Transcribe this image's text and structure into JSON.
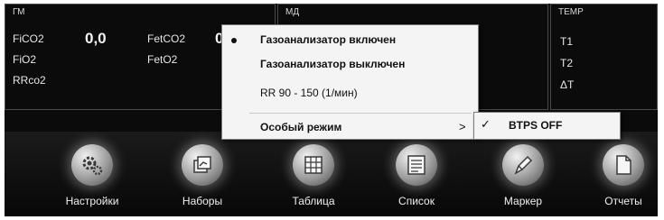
{
  "gm": {
    "title": "ГМ",
    "fico2_label": "FiCO2",
    "fico2_value": "0,0",
    "fio2_label": "FiO2",
    "rrco2_label": "RRco2",
    "fetco2_label": "FetCO2",
    "fetco2_value": "0",
    "feto2_label": "FetO2"
  },
  "md": {
    "title": "МД"
  },
  "temp": {
    "title": "TEMP",
    "t1_label": "T1",
    "t2_label": "T2",
    "dt_label": "ΔT"
  },
  "dock": {
    "items": [
      {
        "label": "Настройки",
        "icon": "gears-icon"
      },
      {
        "label": "Наборы",
        "icon": "sets-icon"
      },
      {
        "label": "Таблица",
        "icon": "table-icon"
      },
      {
        "label": "Список",
        "icon": "list-icon"
      },
      {
        "label": "Маркер",
        "icon": "marker-icon"
      },
      {
        "label": "Отчеты",
        "icon": "reports-icon"
      }
    ]
  },
  "menu": {
    "items": [
      {
        "label": "Газоанализатор включен",
        "selected": true
      },
      {
        "label": "Газоанализатор выключен"
      },
      {
        "label": "RR 90 - 150 (1/мин)"
      },
      {
        "label": "Особый режим",
        "submenu": true
      }
    ],
    "submenu_item": {
      "label": "BTPS OFF",
      "checked": true
    }
  }
}
